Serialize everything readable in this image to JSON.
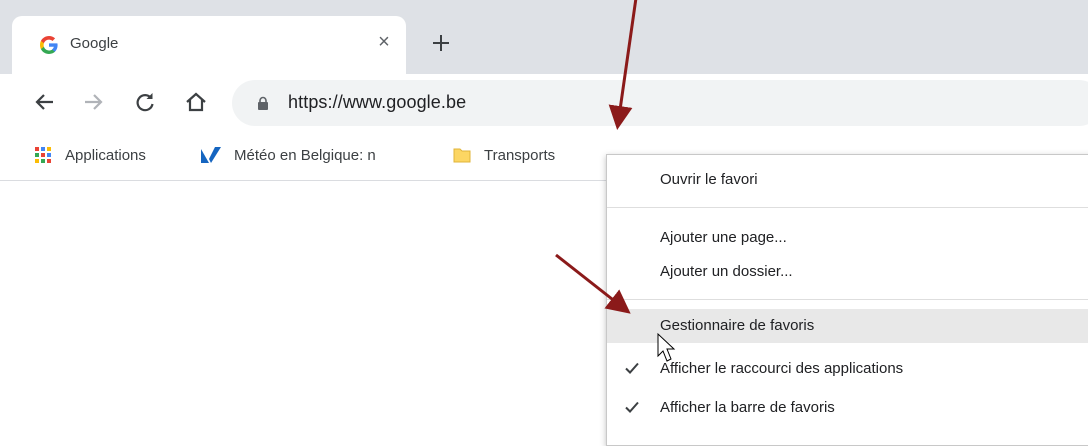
{
  "tab": {
    "title": "Google",
    "close_glyph": "×",
    "newtab_glyph": "+"
  },
  "toolbar": {
    "url": "https://www.google.be"
  },
  "bookmarks": [
    {
      "label": "Applications",
      "icon": "apps-grid-icon"
    },
    {
      "label": "Météo en Belgique: n",
      "icon": "meteo-logo-icon"
    },
    {
      "label": "Transports",
      "icon": "folder-icon"
    }
  ],
  "menu": {
    "items": [
      {
        "label": "Ouvrir le favori",
        "checked": false
      },
      {
        "label": "Ajouter une page...",
        "checked": false
      },
      {
        "label": "Ajouter un dossier...",
        "checked": false
      },
      {
        "label": "Gestionnaire de favoris",
        "checked": false,
        "highlighted": true
      },
      {
        "label": "Afficher le raccourci des applications",
        "checked": true
      },
      {
        "label": "Afficher la barre de favoris",
        "checked": true
      }
    ]
  },
  "colors": {
    "tabstrip": "#dee1e6",
    "omnibox": "#f1f3f4",
    "arrow": "#8b1a1a",
    "menu_highlight": "#e8e8e8"
  }
}
